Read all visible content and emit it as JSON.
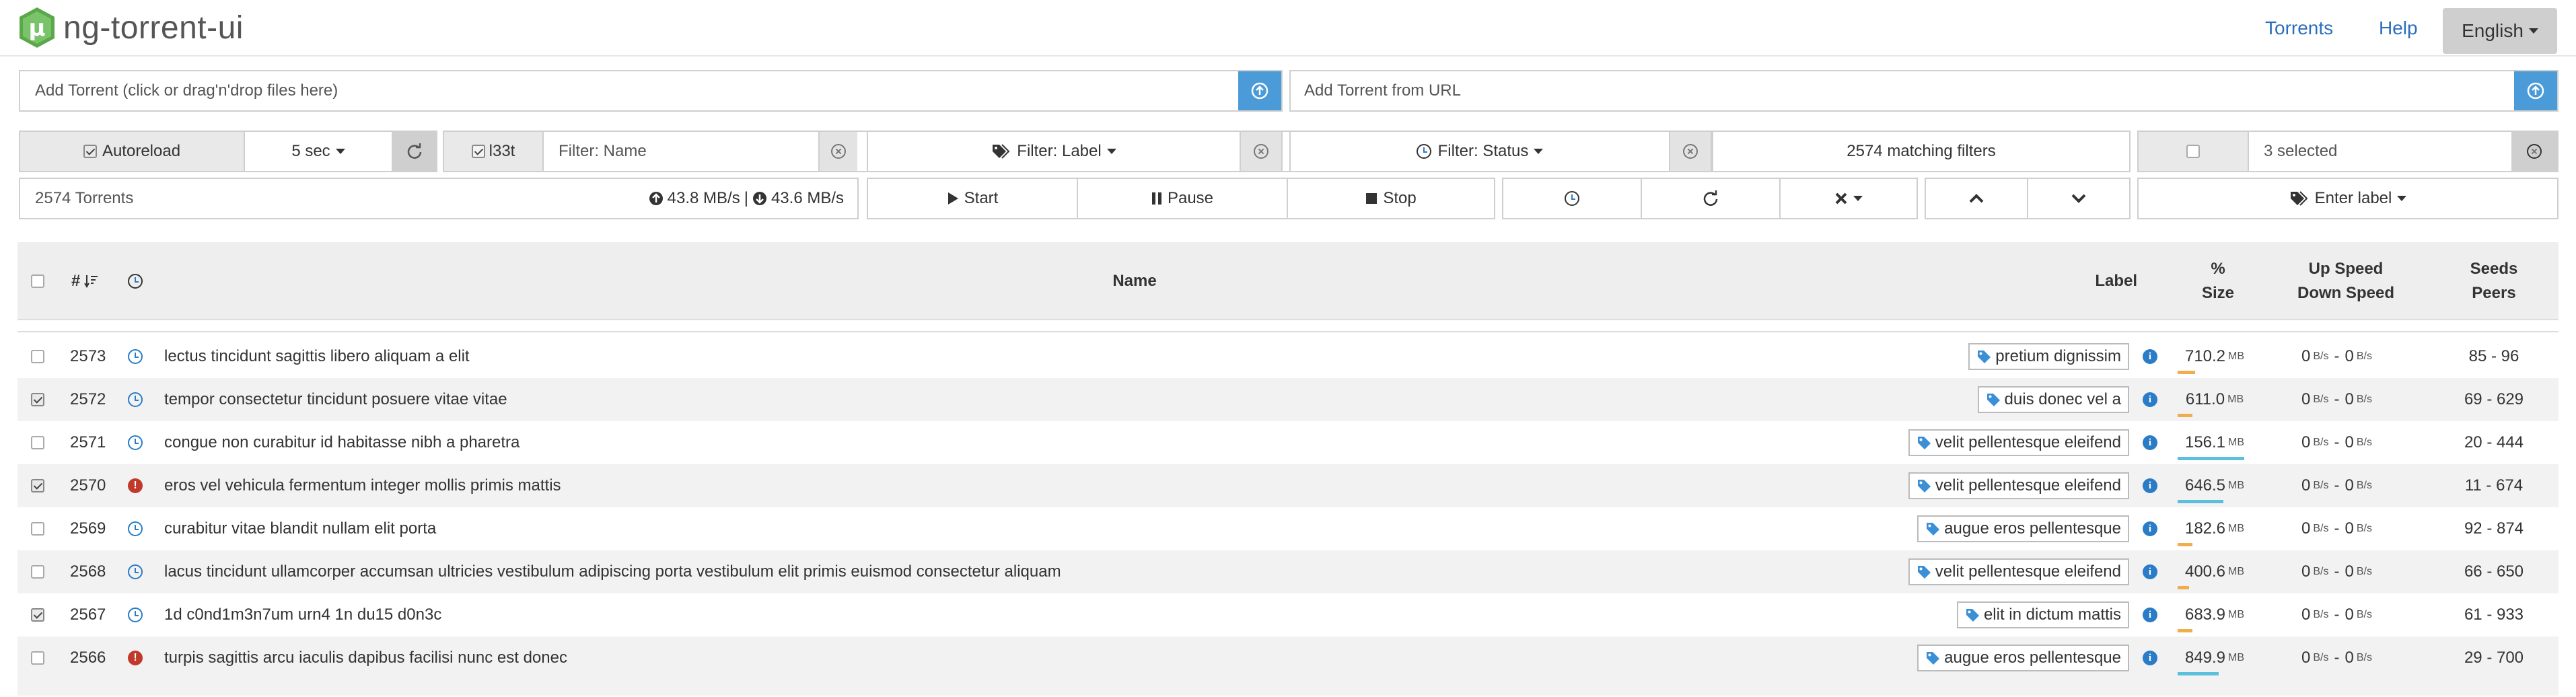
{
  "brand": {
    "name": "ng-torrent-ui",
    "logo_letter": "μ"
  },
  "nav": {
    "torrents": "Torrents",
    "help": "Help",
    "language": "English"
  },
  "add": {
    "file_placeholder": "Add Torrent (click or drag'n'drop files here)",
    "url_placeholder": "Add Torrent from URL"
  },
  "filters": {
    "autoreload": "Autoreload",
    "interval": "5 sec",
    "l33t": "l33t",
    "name_placeholder": "Filter: Name",
    "label": "Filter: Label",
    "status": "Filter: Status",
    "matching": "2574 matching filters",
    "selected": "3 selected"
  },
  "stats": {
    "count": "2574 Torrents",
    "up": "43.8 MB/s",
    "sep": "|",
    "down": "43.6 MB/s"
  },
  "actions": {
    "start": "Start",
    "pause": "Pause",
    "stop": "Stop",
    "enter_label": "Enter label"
  },
  "table": {
    "headers": {
      "num": "#",
      "name": "Name",
      "label": "Label",
      "pct": "%",
      "size": "Size",
      "up": "Up Speed",
      "down": "Down Speed",
      "seeds": "Seeds",
      "peers": "Peers"
    },
    "rows": [
      {
        "num": "2573",
        "checked": false,
        "status": "queued",
        "name": "lectus tincidunt sagittis libero aliquam a elit",
        "label": "pretium dignissim",
        "size": "710.2",
        "unit": "MB",
        "up": "0",
        "down": "0",
        "speed_unit": "B/s",
        "sp": "85 - 96",
        "progress": 0.24,
        "bar_color": "#f0ad4e"
      },
      {
        "num": "2572",
        "checked": true,
        "status": "queued",
        "name": "tempor consectetur tincidunt posuere vitae vitae",
        "label": "duis donec vel a",
        "size": "611.0",
        "unit": "MB",
        "up": "0",
        "down": "0",
        "speed_unit": "B/s",
        "sp": "69 - 629",
        "progress": 0.2,
        "bar_color": "#f0ad4e"
      },
      {
        "num": "2571",
        "checked": false,
        "status": "queued",
        "name": "congue non curabitur id habitasse nibh a pharetra",
        "label": "velit pellentesque eleifend",
        "size": "156.1",
        "unit": "MB",
        "up": "0",
        "down": "0",
        "speed_unit": "B/s",
        "sp": "20 - 444",
        "progress": 0.9,
        "bar_color": "#5bc0de"
      },
      {
        "num": "2570",
        "checked": true,
        "status": "error",
        "name": "eros vel vehicula fermentum integer mollis primis mattis",
        "label": "velit pellentesque eleifend",
        "size": "646.5",
        "unit": "MB",
        "up": "0",
        "down": "0",
        "speed_unit": "B/s",
        "sp": "11 - 674",
        "progress": 0.62,
        "bar_color": "#5bc0de"
      },
      {
        "num": "2569",
        "checked": false,
        "status": "queued",
        "name": "curabitur vitae blandit nullam elit porta",
        "label": "augue eros pellentesque",
        "size": "182.6",
        "unit": "MB",
        "up": "0",
        "down": "0",
        "speed_unit": "B/s",
        "sp": "92 - 874",
        "progress": 0.2,
        "bar_color": "#f0ad4e"
      },
      {
        "num": "2568",
        "checked": false,
        "status": "queued",
        "name": "lacus tincidunt ullamcorper accumsan ultricies vestibulum adipiscing porta vestibulum elit primis euismod consectetur aliquam",
        "label": "velit pellentesque eleifend",
        "size": "400.6",
        "unit": "MB",
        "up": "0",
        "down": "0",
        "speed_unit": "B/s",
        "sp": "66 - 650",
        "progress": 0.15,
        "bar_color": "#f0ad4e"
      },
      {
        "num": "2567",
        "checked": true,
        "status": "queued",
        "name": "1d c0nd1m3n7um urn4 1n du15 d0n3c",
        "label": "elit in dictum mattis",
        "size": "683.9",
        "unit": "MB",
        "up": "0",
        "down": "0",
        "speed_unit": "B/s",
        "sp": "61 - 933",
        "progress": 0.2,
        "bar_color": "#f0ad4e"
      },
      {
        "num": "2566",
        "checked": false,
        "status": "error",
        "name": "turpis sagittis arcu iaculis dapibus facilisi nunc est donec",
        "label": "augue eros pellentesque",
        "size": "849.9",
        "unit": "MB",
        "up": "0",
        "down": "0",
        "speed_unit": "B/s",
        "sp": "29 - 700",
        "progress": 0.55,
        "bar_color": "#5bc0de"
      }
    ]
  },
  "colors": {
    "accent": "#4a9bd8",
    "link": "#2a6ebd",
    "progress_orange": "#f0ad4e",
    "progress_blue": "#5bc0de",
    "error": "#c0392b"
  }
}
